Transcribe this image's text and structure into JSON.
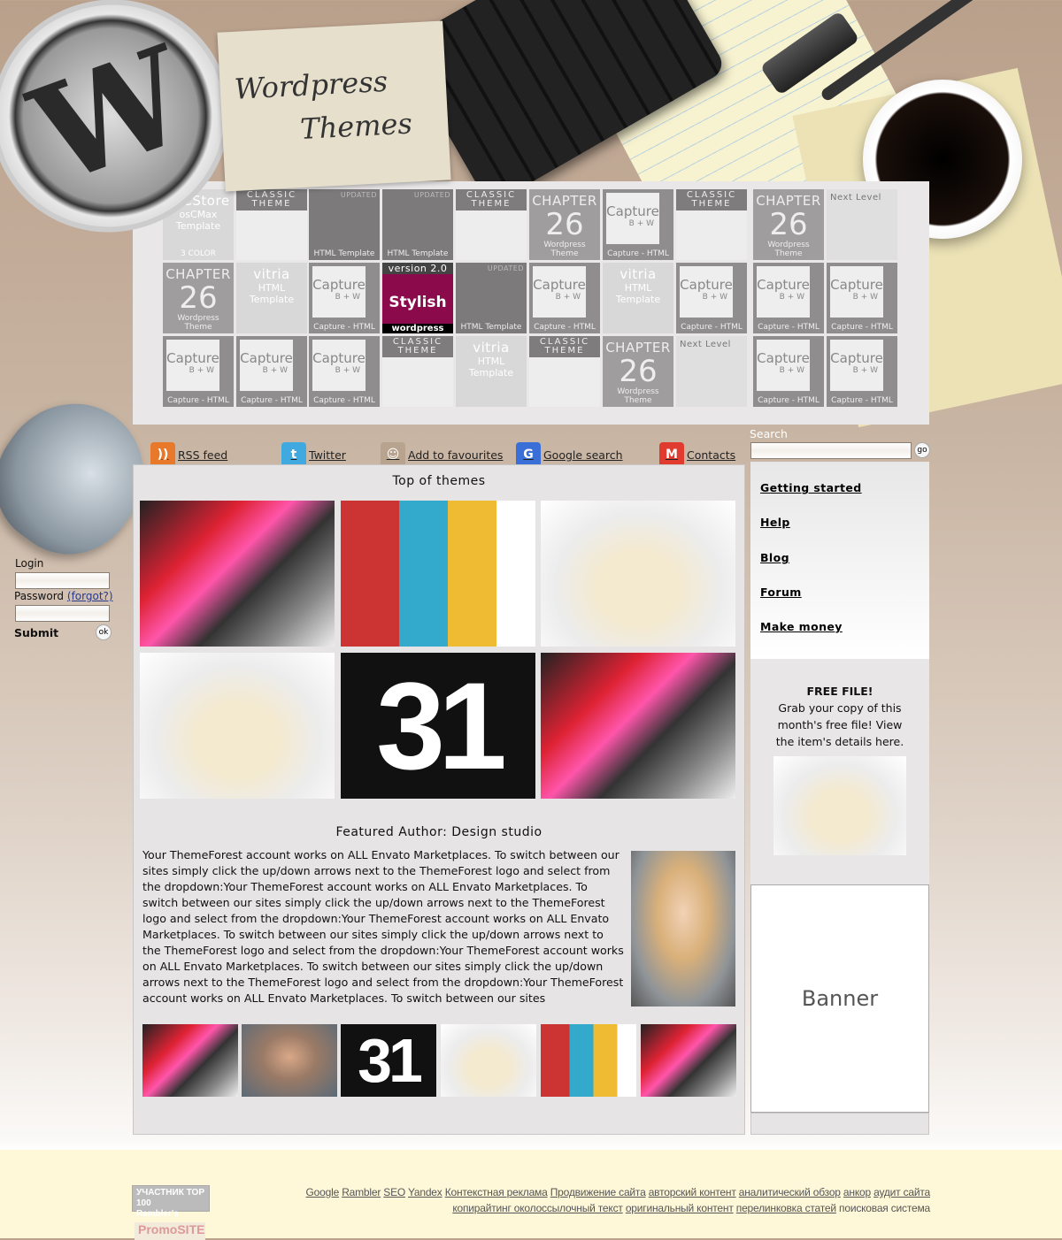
{
  "header": {
    "note_line1": "Wordpress",
    "note_line2": "Themes",
    "logo_letter": "W"
  },
  "gallery": {
    "tiles": [
      {
        "type": "light",
        "title": "osCStore",
        "sub": "osCMax Template",
        "caption": "3 COLOR"
      },
      {
        "type": "classic",
        "title": "CLASSIC THEME",
        "caption": ""
      },
      {
        "type": "dark",
        "title": "UPDATED",
        "caption": "HTML Template"
      },
      {
        "type": "dark",
        "title": "UPDATED",
        "caption": "HTML Template"
      },
      {
        "type": "classic",
        "title": "CLASSIC THEME",
        "caption": ""
      },
      {
        "type": "chapter",
        "title": "CHAPTER",
        "sub": "26",
        "caption": "Wordpress Theme"
      },
      {
        "type": "capture",
        "title": "Capture",
        "sub": "B + W",
        "caption": "Capture - HTML"
      },
      {
        "type": "classic",
        "title": "CLASSIC THEME",
        "caption": ""
      },
      {
        "type": "chapter",
        "title": "CHAPTER",
        "sub": "26",
        "caption": "Wordpress Theme"
      },
      {
        "type": "next",
        "title": "Next Level",
        "caption": ""
      },
      {
        "type": "chapter",
        "title": "CHAPTER",
        "sub": "26",
        "caption": "Wordpress Theme"
      },
      {
        "type": "light",
        "title": "vitria",
        "sub": "HTML Template",
        "caption": ""
      },
      {
        "type": "capture",
        "title": "Capture",
        "sub": "B + W",
        "caption": "Capture - HTML"
      },
      {
        "type": "stylish",
        "title": "version 2.0",
        "sub": "Stylish",
        "caption": "wordpress"
      },
      {
        "type": "dark",
        "title": "UPDATED",
        "caption": "HTML Template"
      },
      {
        "type": "capture",
        "title": "Capture",
        "sub": "B + W",
        "caption": "Capture - HTML"
      },
      {
        "type": "light",
        "title": "vitria",
        "sub": "HTML Template",
        "caption": ""
      },
      {
        "type": "capture",
        "title": "Capture",
        "sub": "B + W",
        "caption": "Capture - HTML"
      },
      {
        "type": "capture",
        "title": "Capture",
        "sub": "B + W",
        "caption": "Capture - HTML"
      },
      {
        "type": "capture",
        "title": "Capture",
        "sub": "B + W",
        "caption": "Capture - HTML"
      },
      {
        "type": "capture",
        "title": "Capture",
        "sub": "B + W",
        "caption": "Capture - HTML"
      },
      {
        "type": "capture",
        "title": "Capture",
        "sub": "B + W",
        "caption": "Capture - HTML"
      },
      {
        "type": "capture",
        "title": "Capture",
        "sub": "B + W",
        "caption": "Capture - HTML"
      },
      {
        "type": "classic",
        "title": "CLASSIC THEME",
        "caption": ""
      },
      {
        "type": "light",
        "title": "vitria",
        "sub": "HTML Template",
        "caption": ""
      },
      {
        "type": "classic",
        "title": "CLASSIC THEME",
        "caption": ""
      },
      {
        "type": "chapter",
        "title": "CHAPTER",
        "sub": "26",
        "caption": "Wordpress Theme"
      },
      {
        "type": "next",
        "title": "Next Level",
        "caption": ""
      },
      {
        "type": "capture",
        "title": "Capture",
        "sub": "B + W",
        "caption": "Capture - HTML"
      },
      {
        "type": "capture",
        "title": "Capture",
        "sub": "B + W",
        "caption": "Capture - HTML"
      }
    ]
  },
  "nav": [
    {
      "label": "RSS feed",
      "icon": "rss-icon",
      "color": "#e8782a",
      "glyph": "))"
    },
    {
      "label": "Twitter",
      "icon": "twitter-bird-icon",
      "color": "#3fa9e0",
      "glyph": "t"
    },
    {
      "label": "Add to favourites",
      "icon": "favourites-icon",
      "color": "#b7a38e",
      "glyph": "☺"
    },
    {
      "label": "Google search",
      "icon": "google-icon",
      "color": "#3b6fd8",
      "glyph": "G"
    },
    {
      "label": "Contacts",
      "icon": "gmail-icon",
      "color": "#e03b2e",
      "glyph": "M"
    }
  ],
  "login": {
    "login_label": "Login",
    "password_label": "Password",
    "forgot_label": "(forgot?)",
    "submit_label": "Submit",
    "ok_label": "ok"
  },
  "search": {
    "label": "Search",
    "go_label": "go",
    "value": ""
  },
  "main": {
    "top_title": "Top of themes",
    "featured_title": "Featured Author: Design studio",
    "featured_text": "Your ThemeForest account works on ALL Envato Marketplaces. To switch between our sites simply click the up/down arrows next to the ThemeForest logo and select from the dropdown:Your ThemeForest account works on ALL Envato Marketplaces. To switch between our sites simply click the up/down arrows next to the ThemeForest logo and select from the dropdown:Your ThemeForest account works on ALL Envato Marketplaces. To switch between our sites simply click the up/down arrows next to the ThemeForest logo and select from the dropdown:Your ThemeForest account works on ALL Envato Marketplaces. To switch between our sites simply click the up/down arrows next to the ThemeForest logo and select from the dropdown:Your ThemeForest account works on ALL Envato Marketplaces. To switch between our sites",
    "top_images": [
      "collage",
      "grid",
      "bottles",
      "bottles",
      "31",
      "collage"
    ],
    "strip_images": [
      "collage",
      "man",
      "31",
      "bottles",
      "grid",
      "collage"
    ],
    "numeral": "31"
  },
  "sidebar": {
    "links": [
      "Getting started",
      "Help",
      "Blog",
      "Forum",
      "Make money"
    ],
    "free_title": "FREE FILE!",
    "free_text": "Grab your copy of this month's free file! View the item's details here.",
    "banner": "Banner"
  },
  "footer": {
    "links_line1": [
      "Google",
      "Rambler",
      "SEO",
      "Yandex",
      "Контекстная реклама",
      "Продвижение сайта",
      "авторский контент",
      "аналитический обзор",
      "анкор",
      "аудит сайта"
    ],
    "links_line2": [
      "копирайтинг околоссылочный текст",
      "оригинальный контент",
      "перелинковка статей"
    ],
    "line2_plain": "поисковая система",
    "badge1_line1": "УЧАСТНИК",
    "badge1_line2": "Rambler's",
    "badge1_top": "TOP 100",
    "badge2": "PromoSITE"
  }
}
